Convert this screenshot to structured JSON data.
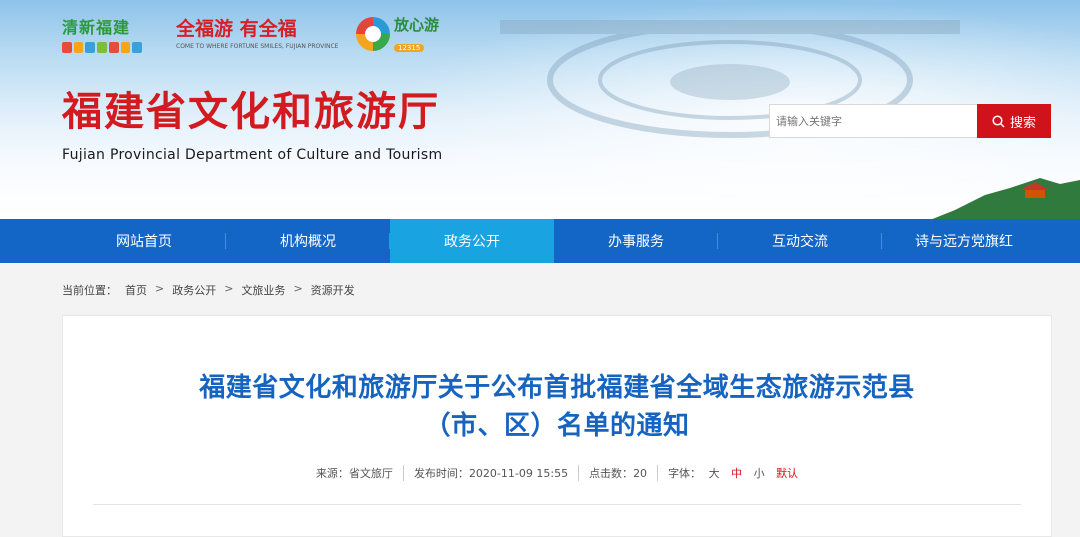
{
  "header": {
    "logo1_text": "清新福建",
    "logo2_text": "全福游 有全福",
    "logo2_tagline": "COME TO WHERE FORTUNE SMILES, FUJIAN PROVINCE",
    "logo3_text": "放心游",
    "logo3_badge": "12315",
    "site_title": "福建省文化和旅游厅",
    "site_subtitle": "Fujian Provincial Department of Culture and Tourism"
  },
  "search": {
    "placeholder": "请输入关键字",
    "button_label": "搜索"
  },
  "nav": {
    "items": [
      "网站首页",
      "机构概况",
      "政务公开",
      "办事服务",
      "互动交流",
      "诗与远方党旗红"
    ],
    "active_index": 2
  },
  "breadcrumb": {
    "prefix": "当前位置：",
    "items": [
      "首页",
      "政务公开",
      "文旅业务",
      "资源开发"
    ]
  },
  "article": {
    "title_line1": "福建省文化和旅游厅关于公布首批福建省全域生态旅游示范县",
    "title_line2": "（市、区）名单的通知",
    "source_label": "来源：",
    "source": "省文旅厅",
    "time_label": "发布时间：",
    "time": "2020-11-09 15:55",
    "clicks_label": "点击数：",
    "clicks": "20",
    "font_label": "字体：",
    "font_large": "大",
    "font_medium": "中",
    "font_small": "小",
    "font_default": "默认"
  },
  "colors": {
    "brand_red": "#d21a1f",
    "nav_blue": "#1366c6",
    "nav_active": "#19a3e1",
    "title_blue": "#1664bf"
  }
}
